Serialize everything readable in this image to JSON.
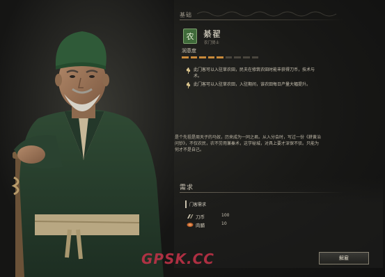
{
  "basic": {
    "section_title": "基础",
    "badge_glyph": "农",
    "name": "綦翟",
    "subtitle": "农门贤士",
    "loyalty_label": "润意度",
    "loyalty_level": 0.55
  },
  "traits": [
    {
      "icon": "wheat-icon",
      "text": "此门客可以入驻草农田，民夫在修筑农田时能丰获得刀币，技术与术。"
    },
    {
      "icon": "wheat-icon",
      "text": "此门客可以入驻草农田，入驻期间，该农田每日产量大幅提升。"
    }
  ],
  "bio": "是个先祖是周天子的马奴，历来成为一同之君。从入分会时，写过一份《耕黄治问钞》，不仅农民，农不劳用兼秦术，这学秘城，对具上要才深保不驳。只能为何才不是自己。",
  "requirements": {
    "title": "需求",
    "subtitle": "门客需求",
    "items": [
      {
        "icon": "coin-icon",
        "name": "刀币",
        "qty": "100"
      },
      {
        "icon": "meat-icon",
        "name": "肉脯",
        "qty": "10"
      }
    ]
  },
  "actions": {
    "hire_label": "解雇"
  },
  "watermark": "GPSK.CC",
  "colors": {
    "accent": "#c98a3a",
    "badge_green": "#3f6a3a",
    "robe_green": "#2f4a34"
  }
}
